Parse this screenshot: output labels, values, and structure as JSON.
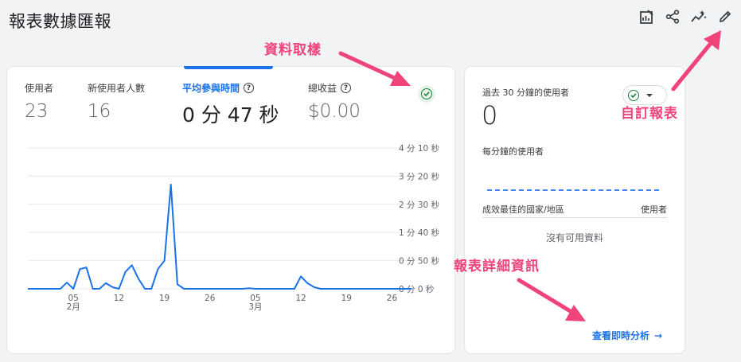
{
  "header": {
    "title": "報表數據匯報",
    "icons": [
      "customize-report-icon",
      "share-icon",
      "insights-icon",
      "edit-icon"
    ]
  },
  "metrics": [
    {
      "label": "使用者",
      "value": "23",
      "help": false,
      "active": false
    },
    {
      "label": "新使用者人數",
      "value": "16",
      "help": false,
      "active": false
    },
    {
      "label": "平均參與時間",
      "value": "0 分 47 秒",
      "help": true,
      "active": true
    },
    {
      "label": "總收益",
      "value": "$0.00",
      "help": true,
      "active": false
    }
  ],
  "chart_data": {
    "type": "line",
    "y_ticks": [
      "4 分 10 秒",
      "3 分 20 秒",
      "2 分 30 秒",
      "1 分 40 秒",
      "0 分 50 秒",
      "0 分 0 秒"
    ],
    "ylim_seconds": [
      0,
      250
    ],
    "x_tick_labels": [
      {
        "day": 7,
        "label": "05",
        "sub": "2月"
      },
      {
        "day": 14,
        "label": "12",
        "sub": ""
      },
      {
        "day": 21,
        "label": "19",
        "sub": ""
      },
      {
        "day": 28,
        "label": "26",
        "sub": ""
      },
      {
        "day": 35,
        "label": "05",
        "sub": "3月"
      },
      {
        "day": 42,
        "label": "12",
        "sub": ""
      },
      {
        "day": 49,
        "label": "19",
        "sub": ""
      },
      {
        "day": 56,
        "label": "26",
        "sub": ""
      }
    ],
    "series": [
      {
        "color": "#1a73e8",
        "values": [
          0,
          0,
          0,
          0,
          0,
          0,
          11,
          0,
          35,
          38,
          0,
          0,
          10,
          3,
          0,
          30,
          42,
          18,
          0,
          0,
          35,
          50,
          185,
          8,
          0,
          0,
          0,
          0,
          0,
          0,
          0,
          0,
          0,
          0,
          1,
          0,
          0,
          0,
          0,
          0,
          0,
          0,
          22,
          10,
          3,
          0,
          0,
          0,
          0,
          0,
          0,
          0,
          0,
          0,
          0,
          0,
          0,
          0,
          0,
          0
        ]
      }
    ],
    "grid": true
  },
  "realtime": {
    "title": "過去 30 分鐘的使用者",
    "value": "0",
    "per_minute_label": "每分鐘的使用者",
    "col_country": "成效最佳的國家/地區",
    "col_users": "使用者",
    "no_data": "沒有可用資料",
    "link": "查看即時分析",
    "link_arrow": "→"
  },
  "annotations": {
    "data_sampling": "資料取樣",
    "customize_report": "自訂報表",
    "report_details": "報表詳細資訊"
  },
  "colors": {
    "accent": "#1a73e8",
    "success": "#188038",
    "annotation": "#f0437a"
  }
}
